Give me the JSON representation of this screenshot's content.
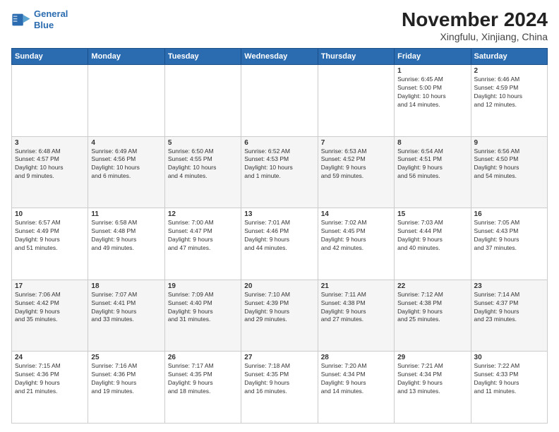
{
  "logo": {
    "line1": "General",
    "line2": "Blue"
  },
  "header": {
    "month": "November 2024",
    "location": "Xingfulu, Xinjiang, China"
  },
  "weekdays": [
    "Sunday",
    "Monday",
    "Tuesday",
    "Wednesday",
    "Thursday",
    "Friday",
    "Saturday"
  ],
  "weeks": [
    [
      {
        "day": "",
        "info": ""
      },
      {
        "day": "",
        "info": ""
      },
      {
        "day": "",
        "info": ""
      },
      {
        "day": "",
        "info": ""
      },
      {
        "day": "",
        "info": ""
      },
      {
        "day": "1",
        "info": "Sunrise: 6:45 AM\nSunset: 5:00 PM\nDaylight: 10 hours\nand 14 minutes."
      },
      {
        "day": "2",
        "info": "Sunrise: 6:46 AM\nSunset: 4:59 PM\nDaylight: 10 hours\nand 12 minutes."
      }
    ],
    [
      {
        "day": "3",
        "info": "Sunrise: 6:48 AM\nSunset: 4:57 PM\nDaylight: 10 hours\nand 9 minutes."
      },
      {
        "day": "4",
        "info": "Sunrise: 6:49 AM\nSunset: 4:56 PM\nDaylight: 10 hours\nand 6 minutes."
      },
      {
        "day": "5",
        "info": "Sunrise: 6:50 AM\nSunset: 4:55 PM\nDaylight: 10 hours\nand 4 minutes."
      },
      {
        "day": "6",
        "info": "Sunrise: 6:52 AM\nSunset: 4:53 PM\nDaylight: 10 hours\nand 1 minute."
      },
      {
        "day": "7",
        "info": "Sunrise: 6:53 AM\nSunset: 4:52 PM\nDaylight: 9 hours\nand 59 minutes."
      },
      {
        "day": "8",
        "info": "Sunrise: 6:54 AM\nSunset: 4:51 PM\nDaylight: 9 hours\nand 56 minutes."
      },
      {
        "day": "9",
        "info": "Sunrise: 6:56 AM\nSunset: 4:50 PM\nDaylight: 9 hours\nand 54 minutes."
      }
    ],
    [
      {
        "day": "10",
        "info": "Sunrise: 6:57 AM\nSunset: 4:49 PM\nDaylight: 9 hours\nand 51 minutes."
      },
      {
        "day": "11",
        "info": "Sunrise: 6:58 AM\nSunset: 4:48 PM\nDaylight: 9 hours\nand 49 minutes."
      },
      {
        "day": "12",
        "info": "Sunrise: 7:00 AM\nSunset: 4:47 PM\nDaylight: 9 hours\nand 47 minutes."
      },
      {
        "day": "13",
        "info": "Sunrise: 7:01 AM\nSunset: 4:46 PM\nDaylight: 9 hours\nand 44 minutes."
      },
      {
        "day": "14",
        "info": "Sunrise: 7:02 AM\nSunset: 4:45 PM\nDaylight: 9 hours\nand 42 minutes."
      },
      {
        "day": "15",
        "info": "Sunrise: 7:03 AM\nSunset: 4:44 PM\nDaylight: 9 hours\nand 40 minutes."
      },
      {
        "day": "16",
        "info": "Sunrise: 7:05 AM\nSunset: 4:43 PM\nDaylight: 9 hours\nand 37 minutes."
      }
    ],
    [
      {
        "day": "17",
        "info": "Sunrise: 7:06 AM\nSunset: 4:42 PM\nDaylight: 9 hours\nand 35 minutes."
      },
      {
        "day": "18",
        "info": "Sunrise: 7:07 AM\nSunset: 4:41 PM\nDaylight: 9 hours\nand 33 minutes."
      },
      {
        "day": "19",
        "info": "Sunrise: 7:09 AM\nSunset: 4:40 PM\nDaylight: 9 hours\nand 31 minutes."
      },
      {
        "day": "20",
        "info": "Sunrise: 7:10 AM\nSunset: 4:39 PM\nDaylight: 9 hours\nand 29 minutes."
      },
      {
        "day": "21",
        "info": "Sunrise: 7:11 AM\nSunset: 4:38 PM\nDaylight: 9 hours\nand 27 minutes."
      },
      {
        "day": "22",
        "info": "Sunrise: 7:12 AM\nSunset: 4:38 PM\nDaylight: 9 hours\nand 25 minutes."
      },
      {
        "day": "23",
        "info": "Sunrise: 7:14 AM\nSunset: 4:37 PM\nDaylight: 9 hours\nand 23 minutes."
      }
    ],
    [
      {
        "day": "24",
        "info": "Sunrise: 7:15 AM\nSunset: 4:36 PM\nDaylight: 9 hours\nand 21 minutes."
      },
      {
        "day": "25",
        "info": "Sunrise: 7:16 AM\nSunset: 4:36 PM\nDaylight: 9 hours\nand 19 minutes."
      },
      {
        "day": "26",
        "info": "Sunrise: 7:17 AM\nSunset: 4:35 PM\nDaylight: 9 hours\nand 18 minutes."
      },
      {
        "day": "27",
        "info": "Sunrise: 7:18 AM\nSunset: 4:35 PM\nDaylight: 9 hours\nand 16 minutes."
      },
      {
        "day": "28",
        "info": "Sunrise: 7:20 AM\nSunset: 4:34 PM\nDaylight: 9 hours\nand 14 minutes."
      },
      {
        "day": "29",
        "info": "Sunrise: 7:21 AM\nSunset: 4:34 PM\nDaylight: 9 hours\nand 13 minutes."
      },
      {
        "day": "30",
        "info": "Sunrise: 7:22 AM\nSunset: 4:33 PM\nDaylight: 9 hours\nand 11 minutes."
      }
    ]
  ]
}
